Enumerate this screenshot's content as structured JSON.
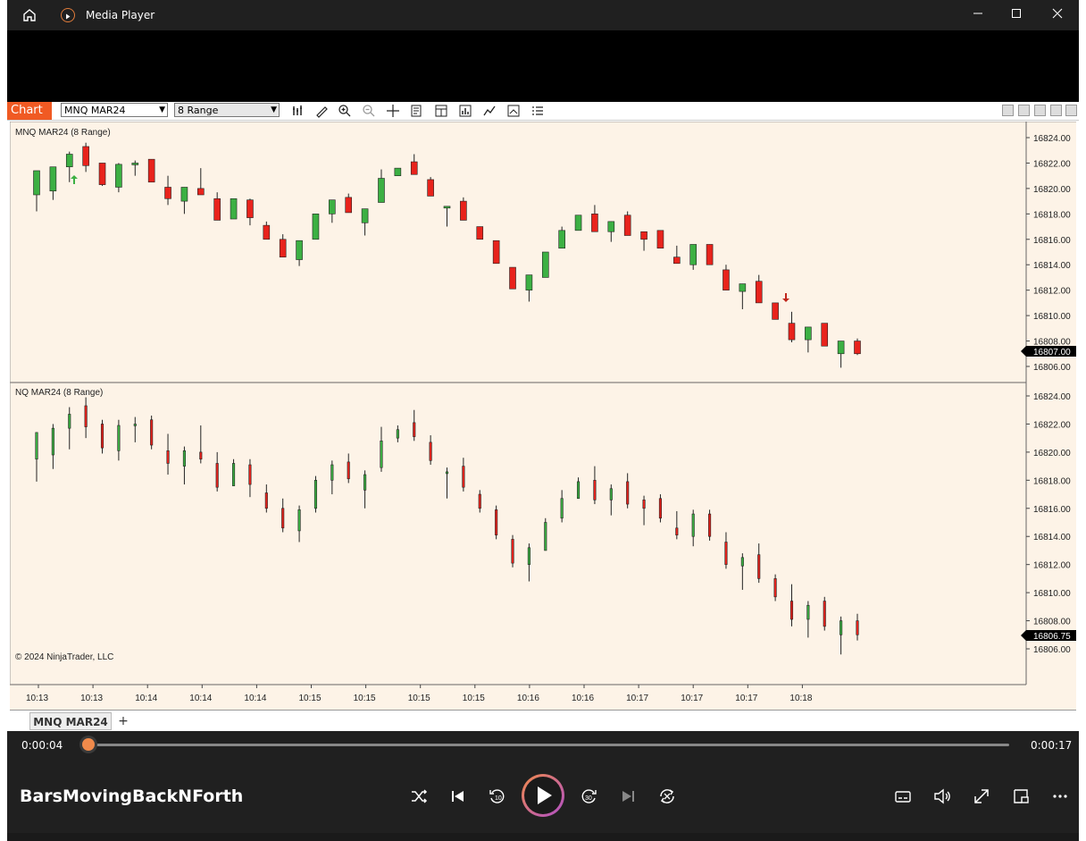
{
  "window": {
    "title": "Media Player"
  },
  "chart": {
    "tab_label": "Chart",
    "instrument_select": "MNQ MAR24",
    "period_select": "8 Range",
    "panel1_label": "MNQ MAR24 (8 Range)",
    "panel2_label": "NQ MAR24 (8 Range)",
    "copyright": "© 2024 NinjaTrader, LLC",
    "price_ticks_1": [
      "16824.00",
      "16822.00",
      "16820.00",
      "16818.00",
      "16816.00",
      "16814.00",
      "16812.00",
      "16810.00",
      "16808.00",
      "16806.00"
    ],
    "price_ticks_2": [
      "16824.00",
      "16822.00",
      "16820.00",
      "16818.00",
      "16816.00",
      "16814.00",
      "16812.00",
      "16810.00",
      "16808.00",
      "16806.00"
    ],
    "last_price_1": "16807.00",
    "last_price_2": "16806.75",
    "time_ticks": [
      "10:13",
      "10:13",
      "10:14",
      "10:14",
      "10:14",
      "10:15",
      "10:15",
      "10:15",
      "10:15",
      "10:16",
      "10:16",
      "10:17",
      "10:17",
      "10:17",
      "10:18"
    ],
    "bottom_tab": "MNQ MAR24",
    "colors": {
      "up": "#3cb043",
      "down": "#e8231c",
      "bg": "#fdf3e7"
    }
  },
  "chart_data": {
    "type": "candlestick",
    "panel1": [
      [
        16819.5,
        16821.4,
        16818.2,
        16819.9
      ],
      [
        16819.8,
        16821.7,
        16819.1,
        16821.7
      ],
      [
        16821.7,
        16822.7,
        16820.5,
        16822.9
      ],
      [
        16823.3,
        16821.8,
        16821.3,
        16823.6
      ],
      [
        16822.0,
        16820.3,
        16820.2,
        16822.0
      ],
      [
        16820.1,
        16821.9,
        16819.7,
        16822.0
      ],
      [
        16822.0,
        16822.0,
        16821.0,
        16822.2
      ],
      [
        16822.3,
        16820.5,
        16820.5,
        16822.3
      ],
      [
        16820.1,
        16819.2,
        16818.7,
        16821.0
      ],
      [
        16819.0,
        16820.1,
        16818.0,
        16820.1
      ],
      [
        16820.0,
        16819.5,
        16819.5,
        16821.6
      ],
      [
        16819.2,
        16817.5,
        16817.5,
        16819.7
      ],
      [
        16817.6,
        16819.2,
        16818.0,
        16819.2
      ],
      [
        16819.1,
        16817.7,
        16817.1,
        16819.2
      ],
      [
        16817.1,
        16816.0,
        16816.0,
        16817.4
      ],
      [
        16816.0,
        16814.6,
        16814.6,
        16816.4
      ],
      [
        16814.4,
        16815.9,
        16813.9,
        16815.9
      ],
      [
        16816.0,
        16818.0,
        16816.0,
        16818.0
      ],
      [
        16818.0,
        16819.1,
        16817.3,
        16819.1
      ],
      [
        16819.3,
        16818.1,
        16818.1,
        16819.6
      ],
      [
        16817.3,
        16818.4,
        16816.3,
        16818.4
      ],
      [
        16818.9,
        16820.8,
        16818.9,
        16821.5
      ],
      [
        16821.0,
        16821.6,
        16821.0,
        16821.6
      ],
      [
        16822.1,
        16821.1,
        16821.1,
        16822.7
      ],
      [
        16820.7,
        16819.4,
        16819.4,
        16820.9
      ],
      [
        16818.6,
        16818.6,
        16817.0,
        16818.6
      ],
      [
        16819.0,
        16817.5,
        16817.5,
        16819.3
      ],
      [
        16817.0,
        16816.0,
        16816.0,
        16817.0
      ],
      [
        16815.9,
        16814.1,
        16814.1,
        16815.9
      ],
      [
        16813.8,
        16812.1,
        16812.1,
        16813.8
      ],
      [
        16812.0,
        16813.2,
        16811.1,
        16813.2
      ],
      [
        16813.0,
        16815.0,
        16815.0,
        16815.0
      ],
      [
        16815.3,
        16816.7,
        16815.3,
        16817.0
      ],
      [
        16816.7,
        16817.9,
        16817.9,
        16817.9
      ],
      [
        16818.0,
        16816.6,
        16816.6,
        16818.7
      ],
      [
        16816.6,
        16817.4,
        16815.8,
        16817.4
      ],
      [
        16817.9,
        16816.3,
        16816.3,
        16818.2
      ],
      [
        16816.6,
        16816.0,
        16815.1,
        16816.6
      ],
      [
        16816.7,
        16815.3,
        16815.3,
        16816.7
      ],
      [
        16814.6,
        16814.1,
        16814.1,
        16815.5
      ],
      [
        16814.0,
        16815.6,
        16813.6,
        16815.6
      ],
      [
        16815.6,
        16814.0,
        16814.0,
        16815.6
      ],
      [
        16813.6,
        16812.0,
        16812.0,
        16814.0
      ],
      [
        16811.9,
        16812.5,
        16810.5,
        16812.5
      ],
      [
        16812.7,
        16811.0,
        16811.0,
        16813.2
      ],
      [
        16811.0,
        16809.7,
        16809.7,
        16811.0
      ],
      [
        16809.4,
        16808.1,
        16807.9,
        16810.3
      ],
      [
        16808.1,
        16809.1,
        16807.1,
        16809.1
      ],
      [
        16809.4,
        16807.6,
        16807.6,
        16809.4
      ],
      [
        16807.0,
        16808.0,
        16805.9,
        16808.0
      ],
      [
        16808.0,
        16807.0,
        16806.9,
        16808.2
      ]
    ]
  },
  "player": {
    "time_current": "0:00:04",
    "time_total": "0:00:17",
    "video_title": "BarsMovingBackNForth",
    "progress": 0.235
  }
}
